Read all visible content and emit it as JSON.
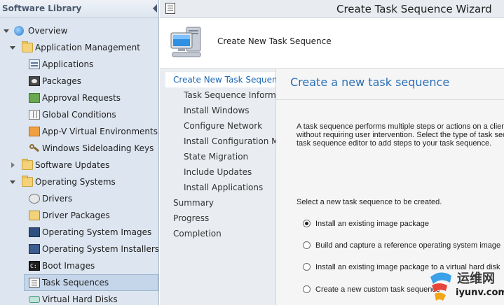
{
  "left_pane": {
    "title": "Software Library",
    "tree": [
      {
        "label": "Overview",
        "icon": "overview-icon",
        "expander": "open"
      },
      {
        "label": "Application Management",
        "icon": "folder-icon",
        "expander": "open"
      },
      {
        "label": "Applications",
        "icon": "applications-icon"
      },
      {
        "label": "Packages",
        "icon": "packages-icon"
      },
      {
        "label": "Approval Requests",
        "icon": "approval-requests-icon"
      },
      {
        "label": "Global Conditions",
        "icon": "global-conditions-icon"
      },
      {
        "label": "App-V Virtual Environments",
        "icon": "appv-icon"
      },
      {
        "label": "Windows Sideloading Keys",
        "icon": "key-icon"
      },
      {
        "label": "Software Updates",
        "icon": "folder-icon",
        "expander": "closed"
      },
      {
        "label": "Operating Systems",
        "icon": "folder-icon",
        "expander": "open"
      },
      {
        "label": "Drivers",
        "icon": "drivers-icon"
      },
      {
        "label": "Driver Packages",
        "icon": "driver-packages-icon"
      },
      {
        "label": "Operating System Images",
        "icon": "os-images-icon"
      },
      {
        "label": "Operating System Installers",
        "icon": "os-installers-icon"
      },
      {
        "label": "Boot Images",
        "icon": "boot-images-icon"
      },
      {
        "label": "Task Sequences",
        "icon": "task-sequences-icon",
        "selected": true
      },
      {
        "label": "Virtual Hard Disks",
        "icon": "virtual-hard-disks-icon"
      }
    ]
  },
  "wizard": {
    "title": "Create Task Sequence Wizard",
    "banner_heading": "Create New Task Sequence",
    "steps": [
      {
        "label": "Create New Task Sequence",
        "current": true
      },
      {
        "label": "Task Sequence Information"
      },
      {
        "label": "Install Windows"
      },
      {
        "label": "Configure Network"
      },
      {
        "label": "Install Configuration Manager"
      },
      {
        "label": "State Migration"
      },
      {
        "label": "Include Updates"
      },
      {
        "label": "Install Applications"
      },
      {
        "label": "Summary"
      },
      {
        "label": "Progress"
      },
      {
        "label": "Completion"
      }
    ],
    "content": {
      "title": "Create a new task sequence",
      "description_lines": [
        "A task sequence performs multiple steps or actions on a client computer",
        "without requiring user intervention. Select the type of task sequence",
        "task sequence editor to add steps to your task sequence."
      ],
      "prompt": "Select a new task sequence to be created.",
      "options": [
        {
          "label": "Install an existing image package",
          "checked": true
        },
        {
          "label": "Build and capture a reference operating system image",
          "checked": false
        },
        {
          "label": "Install an existing image package to a virtual hard disk",
          "checked": false
        },
        {
          "label": "Create a new custom task sequence",
          "checked": false
        }
      ]
    }
  },
  "watermark": {
    "text_cn": "运维网",
    "url": "iyunv.com"
  },
  "colors": {
    "accent": "#2a6fb5",
    "nav_bg": "#dde6f0",
    "steps_bg": "#e9edf1",
    "content_bg": "#f5f5f5"
  }
}
